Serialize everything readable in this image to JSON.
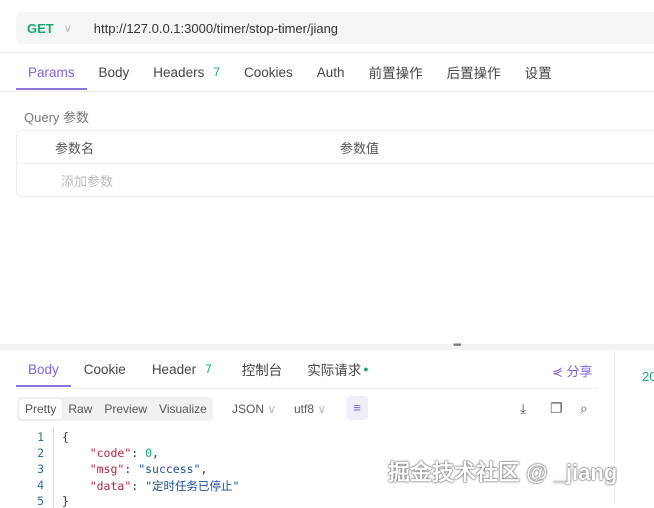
{
  "request": {
    "method": "GET",
    "url": "http://127.0.0.1:3000/timer/stop-timer/jiang"
  },
  "req_tabs": [
    {
      "label": "Params"
    },
    {
      "label": "Body"
    },
    {
      "label": "Headers",
      "badge": "7"
    },
    {
      "label": "Cookies"
    },
    {
      "label": "Auth"
    },
    {
      "label": "前置操作"
    },
    {
      "label": "后置操作"
    },
    {
      "label": "设置"
    }
  ],
  "query": {
    "title": "Query 参数",
    "col_name": "参数名",
    "col_value": "参数值",
    "add_placeholder": "添加参数"
  },
  "resp_tabs": [
    {
      "label": "Body"
    },
    {
      "label": "Cookie"
    },
    {
      "label": "Header",
      "badge": "7"
    },
    {
      "label": "控制台"
    },
    {
      "label": "实际请求"
    }
  ],
  "share": "分享",
  "side_partial": "20",
  "view_modes": [
    "Pretty",
    "Raw",
    "Preview",
    "Visualize"
  ],
  "format": "JSON",
  "encoding": "utf8",
  "code_lines": [
    {
      "n": "1",
      "t": "{"
    },
    {
      "n": "2",
      "k": "\"code\"",
      "v": "0",
      "vt": "n",
      "end": ","
    },
    {
      "n": "3",
      "k": "\"msg\"",
      "v": "\"success\"",
      "vt": "s",
      "end": ","
    },
    {
      "n": "4",
      "k": "\"data\"",
      "v": "\"定时任务已停止\"",
      "vt": "s",
      "end": ""
    },
    {
      "n": "5",
      "t": "}"
    }
  ],
  "watermark": "掘金技术社区 @ _jiang"
}
